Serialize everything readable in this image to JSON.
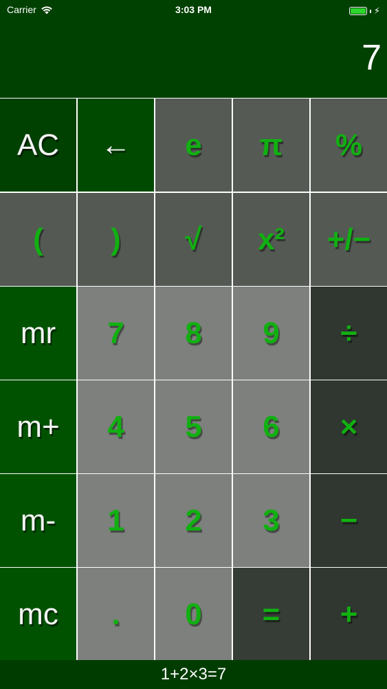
{
  "status_bar": {
    "carrier": "Carrier",
    "time": "3:03 PM",
    "wifi_icon": "wifi-icon",
    "battery_icon": "battery-icon",
    "battery_level": 1.0,
    "charging_icon": "bolt-icon"
  },
  "display": {
    "value": "7"
  },
  "keypad": {
    "rows": [
      [
        {
          "label": "AC",
          "name": "all-clear-button",
          "style": "white",
          "color": "acdark"
        },
        {
          "label": "←",
          "name": "backspace-button",
          "style": "white",
          "color": "backsp"
        },
        {
          "label": "e",
          "name": "euler-button",
          "style": "green",
          "color": "grey1"
        },
        {
          "label": "π",
          "name": "pi-button",
          "style": "green",
          "color": "grey1"
        },
        {
          "label": "%",
          "name": "percent-button",
          "style": "green",
          "color": "grey1"
        }
      ],
      [
        {
          "label": "(",
          "name": "open-paren-button",
          "style": "green",
          "color": "grey2"
        },
        {
          "label": ")",
          "name": "close-paren-button",
          "style": "green",
          "color": "grey2"
        },
        {
          "label": "√",
          "name": "square-root-button",
          "style": "green",
          "color": "grey2"
        },
        {
          "label": "x²",
          "name": "square-button",
          "style": "green",
          "color": "grey2"
        },
        {
          "label": "+/−",
          "name": "negate-button",
          "style": "green",
          "color": "grey2"
        }
      ],
      [
        {
          "label": "mr",
          "name": "memory-recall-button",
          "style": "white",
          "color": "mem"
        },
        {
          "label": "7",
          "name": "digit-7-button",
          "style": "green",
          "color": "digit"
        },
        {
          "label": "8",
          "name": "digit-8-button",
          "style": "green",
          "color": "digit"
        },
        {
          "label": "9",
          "name": "digit-9-button",
          "style": "green",
          "color": "digit"
        },
        {
          "label": "÷",
          "name": "divide-button",
          "style": "green",
          "color": "op"
        }
      ],
      [
        {
          "label": "m+",
          "name": "memory-add-button",
          "style": "white",
          "color": "mem"
        },
        {
          "label": "4",
          "name": "digit-4-button",
          "style": "green",
          "color": "digit"
        },
        {
          "label": "5",
          "name": "digit-5-button",
          "style": "green",
          "color": "digit"
        },
        {
          "label": "6",
          "name": "digit-6-button",
          "style": "green",
          "color": "digit"
        },
        {
          "label": "×",
          "name": "multiply-button",
          "style": "green",
          "color": "op"
        }
      ],
      [
        {
          "label": "m-",
          "name": "memory-subtract-button",
          "style": "white",
          "color": "mem"
        },
        {
          "label": "1",
          "name": "digit-1-button",
          "style": "green",
          "color": "digit"
        },
        {
          "label": "2",
          "name": "digit-2-button",
          "style": "green",
          "color": "digit"
        },
        {
          "label": "3",
          "name": "digit-3-button",
          "style": "green",
          "color": "digit"
        },
        {
          "label": "−",
          "name": "subtract-button",
          "style": "green",
          "color": "op"
        }
      ],
      [
        {
          "label": "mc",
          "name": "memory-clear-button",
          "style": "white",
          "color": "mem"
        },
        {
          "label": ".",
          "name": "decimal-button",
          "style": "green",
          "color": "digit"
        },
        {
          "label": "0",
          "name": "digit-0-button",
          "style": "green",
          "color": "digit"
        },
        {
          "label": "=",
          "name": "equals-button",
          "style": "green",
          "color": "eq"
        },
        {
          "label": "+",
          "name": "add-button",
          "style": "green",
          "color": "op"
        }
      ]
    ]
  },
  "history": {
    "expression": "1+2×3=7"
  },
  "colors": {
    "header_bg": "#004000",
    "key_text_green": "#11b011",
    "key_text_white": "#f4f4f4",
    "grid_line": "#ffffff"
  }
}
